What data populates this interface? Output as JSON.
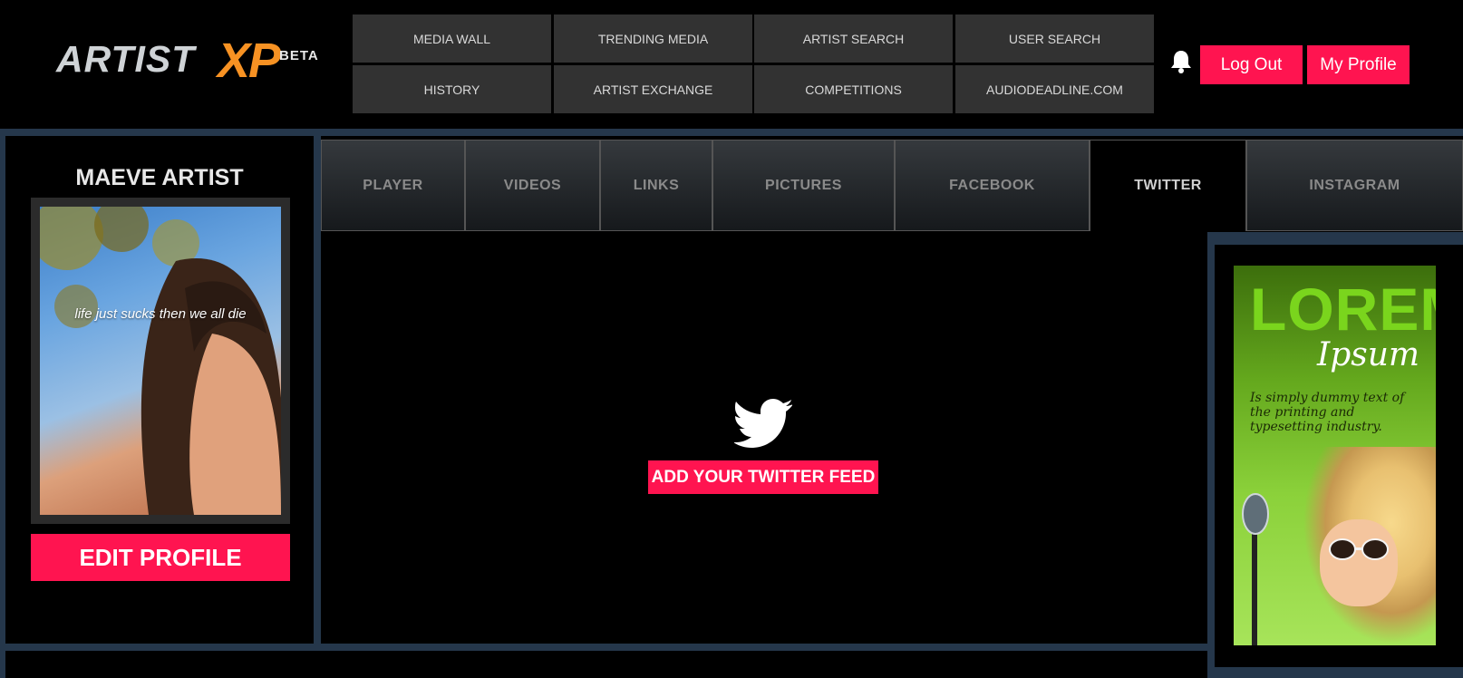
{
  "brand": {
    "logo_main": "ARTIST",
    "logo_accent": "XP",
    "logo_badge": "BETA"
  },
  "nav": {
    "row1": [
      "MEDIA WALL",
      "TRENDING MEDIA",
      "ARTIST SEARCH",
      "USER SEARCH"
    ],
    "row2": [
      "HISTORY",
      "ARTIST EXCHANGE",
      "COMPETITIONS",
      "AUDIODEADLINE.COM"
    ]
  },
  "header_actions": {
    "logout": "Log Out",
    "my_profile": "My Profile",
    "bell_icon": "bell-icon"
  },
  "profile": {
    "name": "MAEVE ARTIST",
    "photo_caption": "life just sucks then we all die",
    "edit_button": "EDIT PROFILE"
  },
  "tabs": [
    "PLAYER",
    "VIDEOS",
    "LINKS",
    "PICTURES",
    "FACEBOOK",
    "TWITTER",
    "INSTAGRAM"
  ],
  "active_tab": "TWITTER",
  "twitter": {
    "icon": "twitter-bird-icon",
    "button": "ADD YOUR TWITTER FEED"
  },
  "ad": {
    "headline": "LOREM",
    "subhead": "Ipsum",
    "body": "Is simply dummy text of the printing and typesetting industry."
  },
  "colors": {
    "accent_red": "#ff1450",
    "border_blue": "#25374b",
    "logo_orange": "#f79223"
  }
}
